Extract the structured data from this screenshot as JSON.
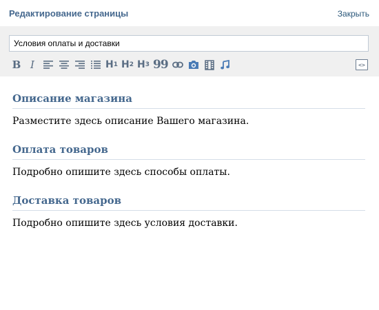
{
  "header": {
    "title": "Редактирование страницы",
    "close_label": "Закрыть"
  },
  "editor": {
    "page_title_value": "Условия оплаты и доставки",
    "toolbar": {
      "bold": "B",
      "italic": "I",
      "h1": "H",
      "h2": "H",
      "h3": "H",
      "h1_num": "1",
      "h2_num": "2",
      "h3_num": "3",
      "quote": "99",
      "source": "<>"
    }
  },
  "content": {
    "sections": [
      {
        "title": "Описание магазина",
        "text": "Разместите здесь описание Вашего магазина."
      },
      {
        "title": "Оплата товаров",
        "text": "Подробно опишите здесь способы оплаты."
      },
      {
        "title": "Доставка товаров",
        "text": "Подробно опишите здесь условия доставки."
      }
    ]
  },
  "colors": {
    "accent": "#45688e",
    "link": "#2b587a",
    "toolbar_bg": "#f0f0f0",
    "icon": "#5a6d83"
  }
}
